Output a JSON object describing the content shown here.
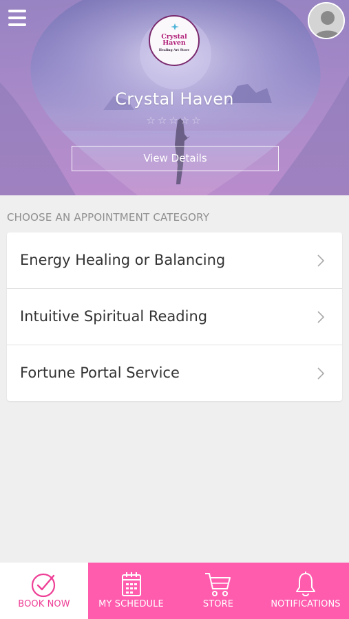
{
  "header": {
    "menu_icon": "hamburger-menu-icon",
    "avatar_icon": "user-avatar-icon",
    "logo": {
      "name": "Crystal Haven",
      "subtitle": "Healing Art Store"
    },
    "business_name": "Crystal Haven",
    "rating_stars": "☆☆☆☆☆",
    "view_details_label": "View Details"
  },
  "categories": {
    "heading": "CHOOSE AN APPOINTMENT CATEGORY",
    "items": [
      {
        "label": "Energy Healing or Balancing"
      },
      {
        "label": "Intuitive Spiritual Reading"
      },
      {
        "label": "Fortune Portal Service"
      }
    ]
  },
  "tabbar": {
    "tabs": [
      {
        "label": "BOOK NOW",
        "icon": "check-circle-icon",
        "active": true
      },
      {
        "label": "MY SCHEDULE",
        "icon": "calendar-icon",
        "active": false
      },
      {
        "label": "STORE",
        "icon": "shopping-cart-icon",
        "active": false
      },
      {
        "label": "NOTIFICATIONS",
        "icon": "bell-icon",
        "active": false
      }
    ]
  },
  "colors": {
    "accent_pink": "#ff5cae",
    "active_tab_text": "#ee3f96",
    "background": "#efefef"
  }
}
